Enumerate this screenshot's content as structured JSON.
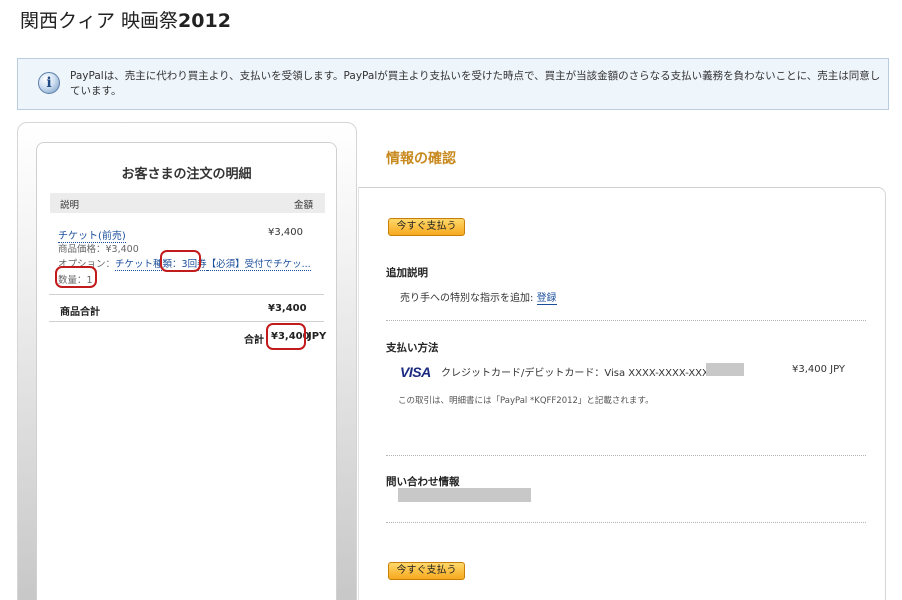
{
  "page": {
    "title_main": "関西クィア 映画祭",
    "title_year": "2012"
  },
  "info": {
    "icon": "info-icon",
    "icon_glyph": "i",
    "text": "PayPalは、売主に代わり買主より、支払いを受領します。PayPalが買主より支払いを受けた時点で、買主が当該金額のさらなる支払い義務を負わないことに、売主は同意しています。"
  },
  "cart": {
    "title": "お客さまの注文の明細",
    "columns": {
      "description": "説明",
      "amount": "金額"
    },
    "item": {
      "name": "チケット(前売)",
      "amount": "¥3,400",
      "price_label": "商品価格：¥3,400",
      "option_label": "オプション：",
      "option_value_1": "チケット種類：",
      "option_value_2": "3回券",
      "option_value_3": "【必須】受付でチケッ...",
      "quantity_label": "数量：1"
    },
    "subtotal": {
      "label": "商品合計",
      "value": "¥3,400"
    },
    "total": {
      "label": "合計",
      "value": "¥3,400",
      "currency": "JPY"
    }
  },
  "review": {
    "title": "情報の確認",
    "pay_now_label": "今すぐ支払う",
    "additional": {
      "heading": "追加説明",
      "text": "売り手への特別な指示を追加:",
      "link": "登録"
    },
    "payment": {
      "heading": "支払い方法",
      "card_brand": "VISA",
      "card_text": "クレジットカード/デビットカード：Visa XXXX-XXXX-XXXX",
      "amount": "¥3,400 JPY",
      "note": "この取引は、明細書には「PayPal *KQFF2012」と記載されます。"
    },
    "contact": {
      "heading": "問い合わせ情報"
    }
  },
  "colors": {
    "accent": "#c88a1e",
    "link": "#1a4e9b",
    "highlight_mark": "#c11b1b",
    "button_top": "#ffd86a",
    "button_bottom": "#f6a91f"
  }
}
